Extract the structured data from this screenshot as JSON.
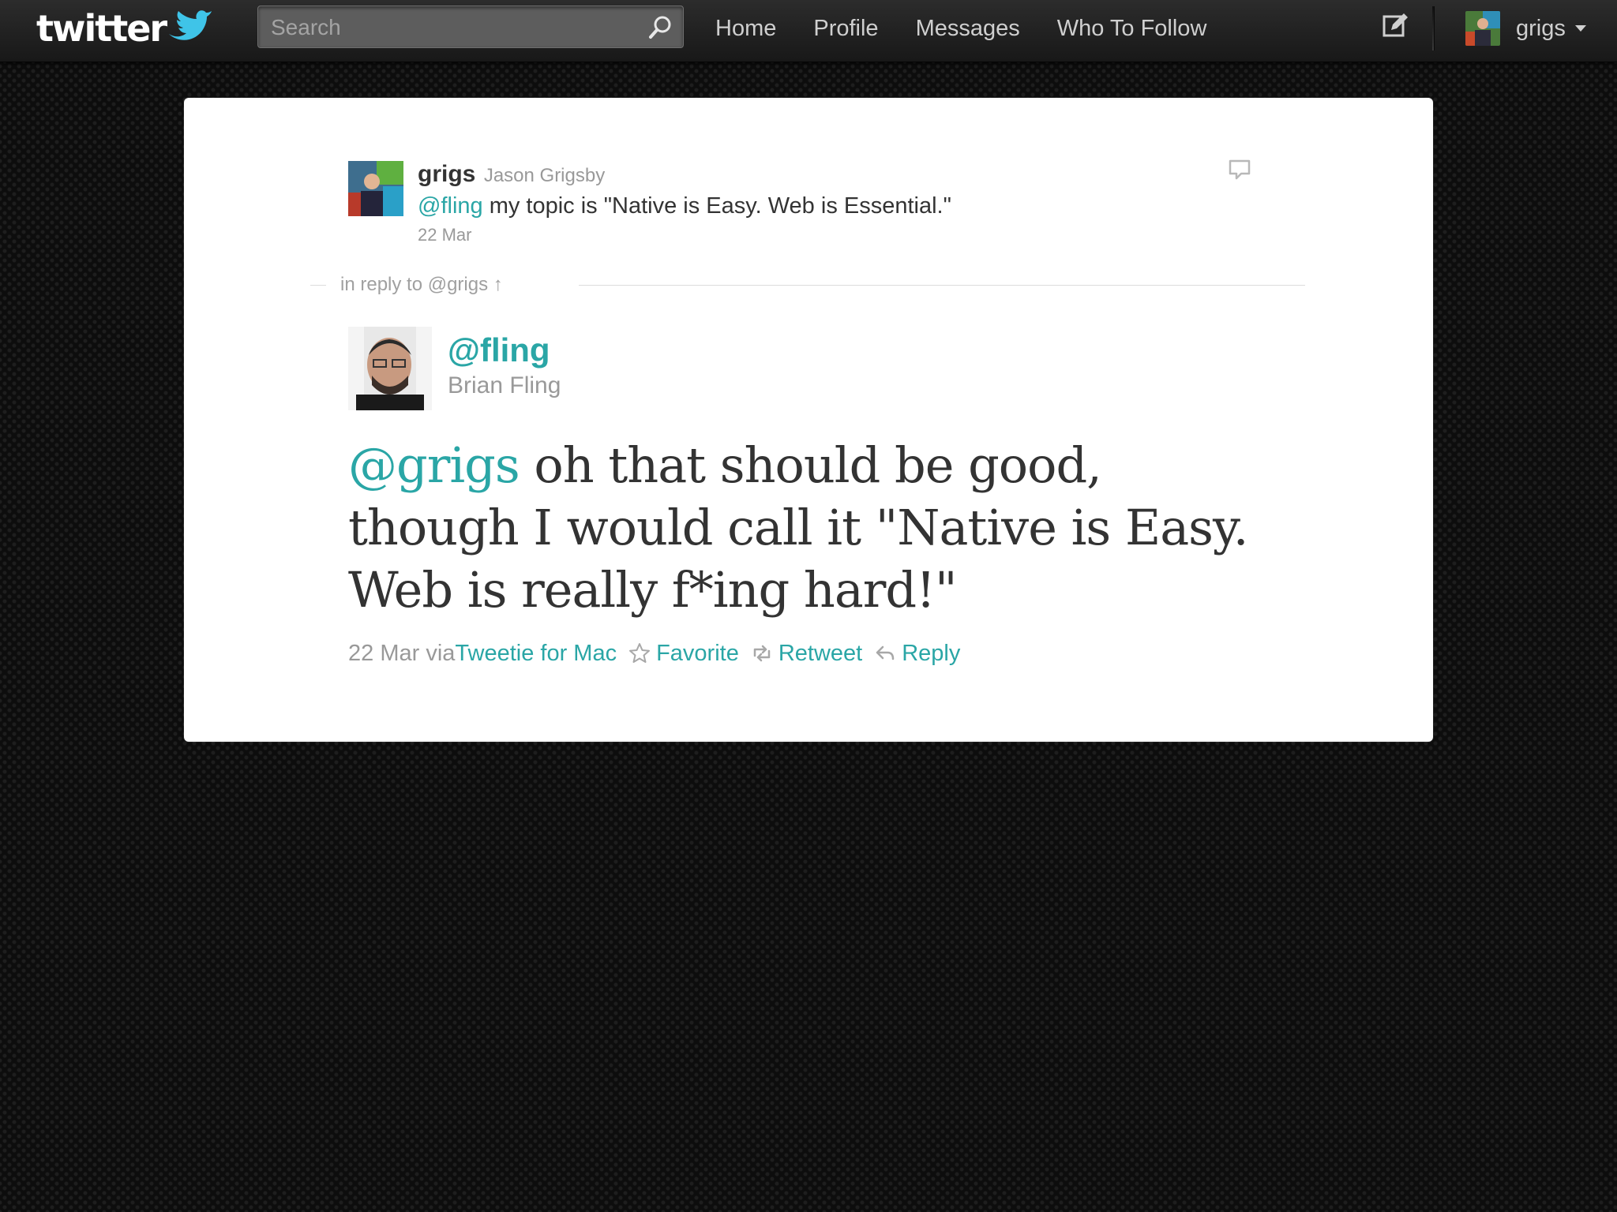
{
  "header": {
    "logo_text": "twitter",
    "search_placeholder": "Search",
    "nav": [
      "Home",
      "Profile",
      "Messages",
      "Who To Follow"
    ],
    "account_name": "grigs"
  },
  "parent_tweet": {
    "screen_name": "grigs",
    "full_name": "Jason Grigsby",
    "mention": "@fling",
    "text": " my topic is \"Native is Easy. Web is Essential.\"",
    "date": "22 Mar"
  },
  "reply_context": "in reply to @grigs ↑",
  "main_tweet": {
    "screen_name": "@fling",
    "full_name": "Brian Fling",
    "mention": "@grigs",
    "text": " oh that should be good, though I would call it \"Native is Easy. Web is really f*ing hard!\"",
    "date_via": "22 Mar via ",
    "client": "Tweetie for Mac",
    "actions": [
      "Favorite",
      "Retweet",
      "Reply"
    ]
  },
  "colors": {
    "accent": "#2aa6a6",
    "text": "#333333",
    "muted": "#999999",
    "topbar": "#222222",
    "background": "#0d0d0d"
  },
  "icons": [
    "bird-logo-icon",
    "search-icon",
    "compose-icon",
    "comment-icon",
    "star-icon",
    "retweet-icon",
    "reply-arrow-icon",
    "caret-down-icon"
  ]
}
